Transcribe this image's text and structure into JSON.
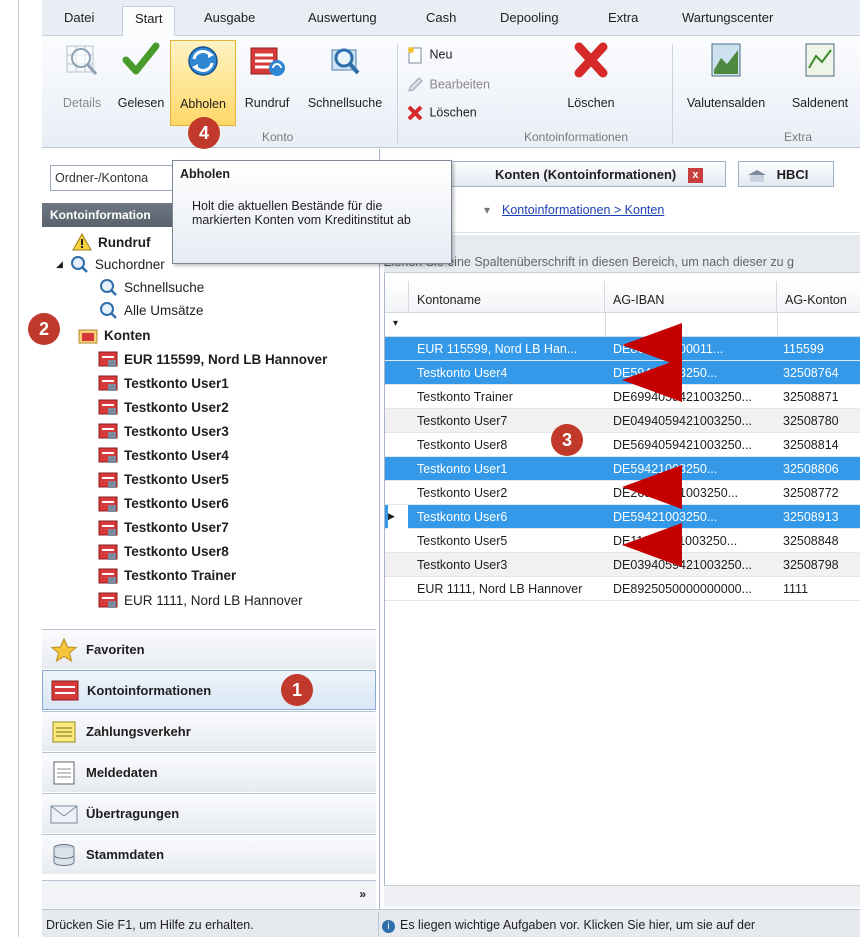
{
  "ribbon": {
    "tabs": [
      "Datei",
      "Start",
      "Ausgabe",
      "Auswertung",
      "Cash",
      "Depooling",
      "Extra",
      "Wartungscenter"
    ],
    "active_tab": "Start",
    "buttons": {
      "details": "Details",
      "gelesen": "Gelesen",
      "abholen": "Abholen",
      "rundruf": "Rundruf",
      "schnellsuche": "Schnellsuche",
      "neu": "Neu",
      "bearbeiten": "Bearbeiten",
      "loeschen_small": "Löschen",
      "loeschen_big": "Löschen",
      "valutensalden": "Valutensalden",
      "saldenent": "Saldenent"
    },
    "groups": {
      "konto": "Konto",
      "kontoinformationen": "Kontoinformationen",
      "extra": "Extra"
    }
  },
  "tooltip": {
    "title": "Abholen",
    "text": "Holt die aktuellen Bestände für die markierten Konten vom Kreditinstitut ab"
  },
  "left_panel": {
    "search_placeholder": "Ordner-/Kontona",
    "header": "Kontoinformation",
    "tree": {
      "rundruf": "Rundruf",
      "suchordner": "Suchordner",
      "schnellsuche": "Schnellsuche",
      "alle_umsaetze": "Alle Umsätze",
      "konten": "Konten",
      "accounts": [
        {
          "label": "EUR 115599, Nord LB Hannover",
          "bold": true
        },
        {
          "label": "Testkonto User1",
          "bold": true
        },
        {
          "label": "Testkonto User2",
          "bold": true
        },
        {
          "label": "Testkonto User3",
          "bold": true
        },
        {
          "label": "Testkonto User4",
          "bold": true
        },
        {
          "label": "Testkonto User5",
          "bold": true
        },
        {
          "label": "Testkonto User6",
          "bold": true
        },
        {
          "label": "Testkonto User7",
          "bold": true
        },
        {
          "label": "Testkonto User8",
          "bold": true
        },
        {
          "label": "Testkonto Trainer",
          "bold": true
        },
        {
          "label": "EUR 1111, Nord LB Hannover",
          "bold": false
        }
      ]
    },
    "nav": {
      "favoriten": "Favoriten",
      "kontoinformationen": "Kontoinformationen",
      "zahlungsverkehr": "Zahlungsverkehr",
      "meldedaten": "Meldedaten",
      "uebertragungen": "Übertragungen",
      "stammdaten": "Stammdaten"
    },
    "chevron": "»"
  },
  "right_pane": {
    "doc_tabs": {
      "konten": "Konten (Kontoinformationen)",
      "close": "x",
      "hbci": "HBCI"
    },
    "breadcrumb": "Kontoinformationen > Konten",
    "group_hint": "Ziehen Sie eine Spaltenüberschrift in diesen Bereich, um nach dieser zu g",
    "columns": [
      "Kontoname",
      "AG-IBAN",
      "AG-Konton"
    ],
    "rows": [
      {
        "name": "EUR 115599, Nord LB Han...",
        "iban": "DE865000000011...",
        "konto": "115599",
        "selected": true
      },
      {
        "name": "Testkonto User4",
        "iban": "DE59421003250...",
        "konto": "32508764",
        "selected": true
      },
      {
        "name": "Testkonto Trainer",
        "iban": "DE6994059421003250...",
        "konto": "32508871",
        "selected": false
      },
      {
        "name": "Testkonto User7",
        "iban": "DE0494059421003250...",
        "konto": "32508780",
        "selected": false
      },
      {
        "name": "Testkonto User8",
        "iban": "DE5694059421003250...",
        "konto": "32508814",
        "selected": false
      },
      {
        "name": "Testkonto User1",
        "iban": "DE59421003250...",
        "konto": "32508806",
        "selected": true
      },
      {
        "name": "Testkonto User2",
        "iban": "DE26945421003250...",
        "konto": "32508772",
        "selected": false
      },
      {
        "name": "Testkonto User6",
        "iban": "DE59421003250...",
        "konto": "32508913",
        "selected": true,
        "current": true
      },
      {
        "name": "Testkonto User5",
        "iban": "DE11945421003250...",
        "konto": "32508848",
        "selected": false
      },
      {
        "name": "Testkonto User3",
        "iban": "DE0394059421003250...",
        "konto": "32508798",
        "selected": false
      },
      {
        "name": "EUR 1111, Nord LB Hannover",
        "iban": "DE8925050000000000...",
        "konto": "1111",
        "selected": false
      }
    ]
  },
  "status_bar": {
    "help": "Drücken Sie F1, um Hilfe zu erhalten.",
    "tasks": "Es liegen wichtige Aufgaben vor. Klicken Sie hier, um sie auf der"
  },
  "callouts": [
    "1",
    "2",
    "3",
    "4"
  ],
  "colors": {
    "selection": "#3399e8",
    "callout": "#c0392b",
    "arrow": "#c40000",
    "link": "#1d3fb5"
  }
}
